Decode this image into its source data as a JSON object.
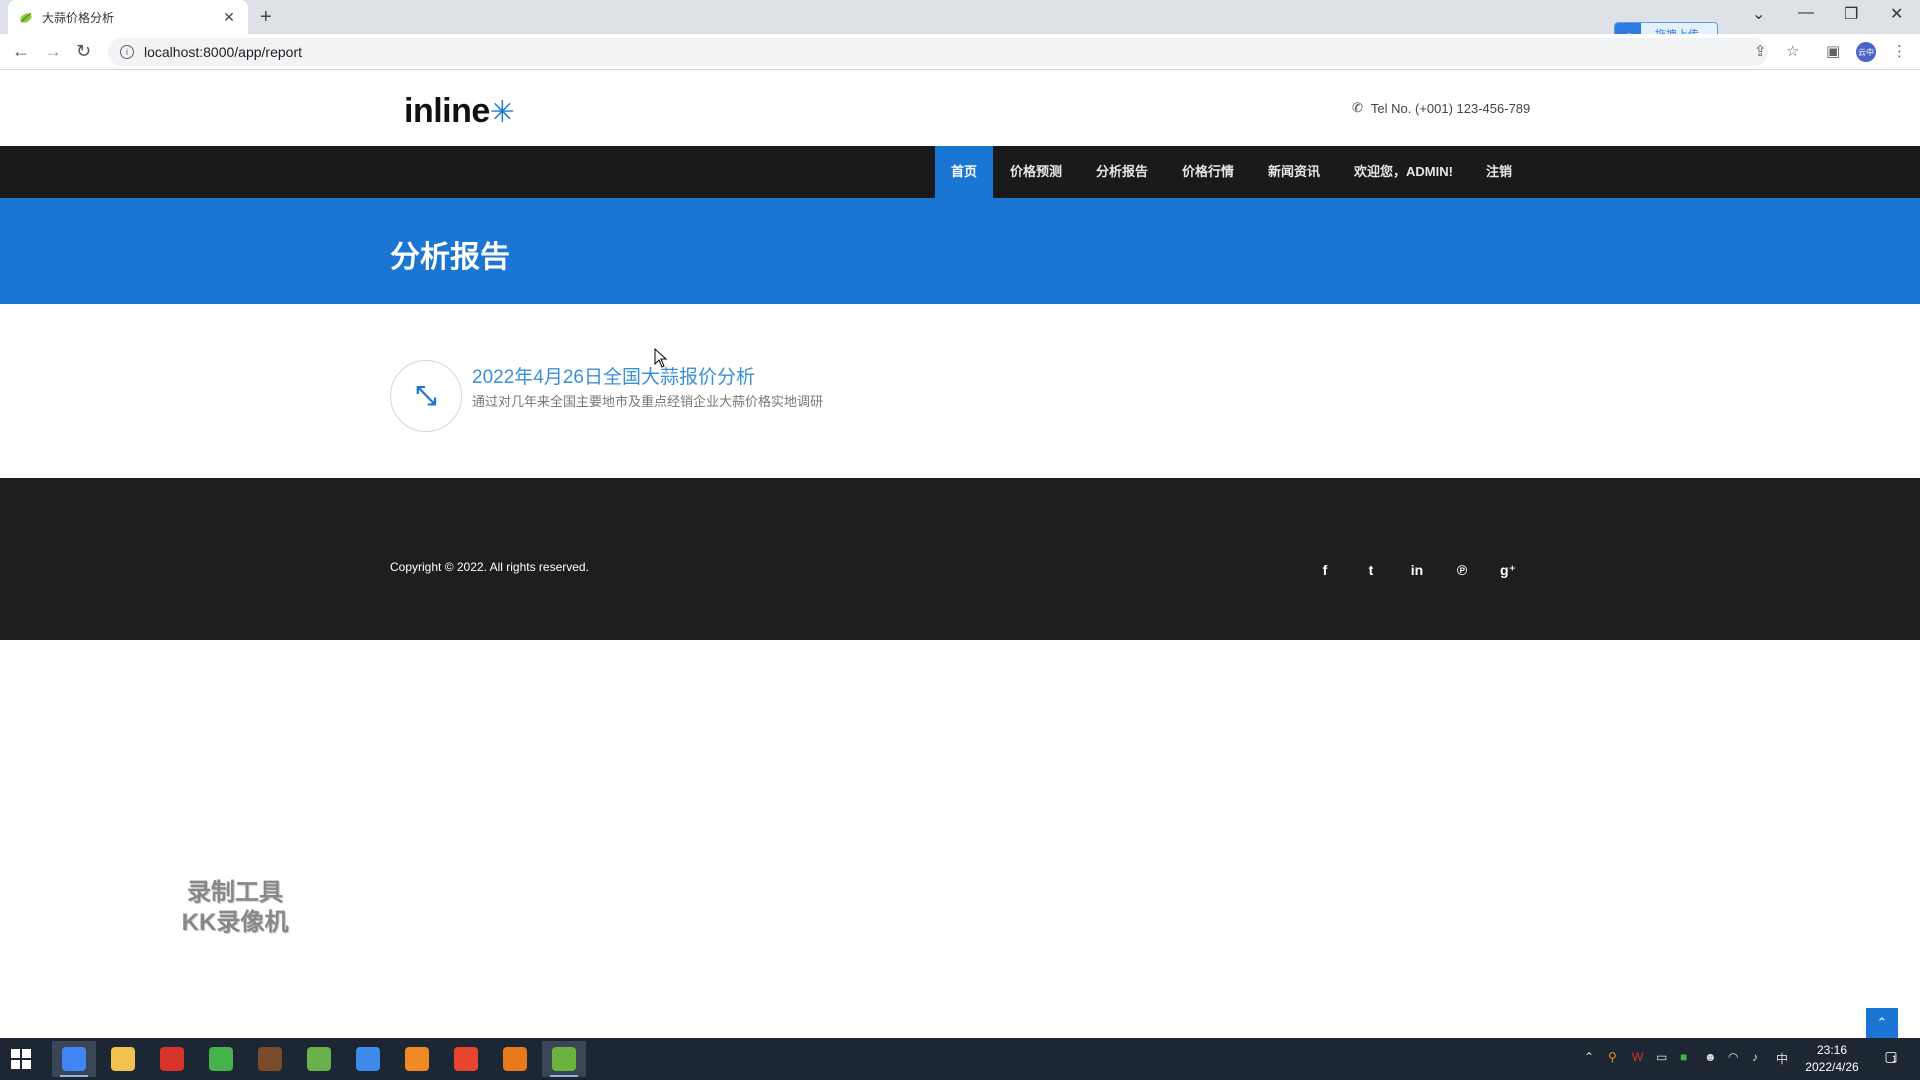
{
  "browser": {
    "tab_title": "大蒜价格分析",
    "tab_close": "✕",
    "new_tab": "+",
    "url": "localhost:8000/app/report",
    "upload_label": "拖拽上传",
    "profile_initials": "云中",
    "window_controls": {
      "minimize": "—",
      "restore": "❐",
      "close": "✕",
      "dropdown": "⌄"
    },
    "nav": {
      "back": "←",
      "forward": "→",
      "reload": "↻"
    }
  },
  "site": {
    "logo_text": "inline",
    "logo_mark": "✳",
    "tel": "Tel No. (+001) 123-456-789",
    "nav": [
      {
        "label": "首页",
        "active": true
      },
      {
        "label": "价格预测"
      },
      {
        "label": "分析报告"
      },
      {
        "label": "价格行情"
      },
      {
        "label": "新闻资讯"
      },
      {
        "label": "欢迎您，ADMIN!"
      },
      {
        "label": "注销"
      }
    ],
    "page_title": "分析报告",
    "report": {
      "title": "2022年4月26日全国大蒜报价分析",
      "description": "通过对几年来全国主要地市及重点经销企业大蒜价格实地调研",
      "icon": "compress-arrows-icon"
    },
    "footer": {
      "copyright": "Copyright © 2022. All rights reserved.",
      "social": [
        {
          "name": "facebook",
          "glyph": "f"
        },
        {
          "name": "twitter",
          "glyph": "t"
        },
        {
          "name": "linkedin",
          "glyph": "in"
        },
        {
          "name": "pinterest",
          "glyph": "℗"
        },
        {
          "name": "google-plus",
          "glyph": "g⁺"
        }
      ]
    },
    "back_to_top": "⌃",
    "watermark_line1": "录制工具",
    "watermark_line2": "KK录像机"
  },
  "taskbar": {
    "time": "23:16",
    "date": "2022/4/26",
    "ime": "中",
    "notification_count": "1",
    "apps": [
      {
        "name": "chrome",
        "color": "#4285f4",
        "active": true
      },
      {
        "name": "file-explorer",
        "color": "#f2c14e"
      },
      {
        "name": "wps-office",
        "color": "#d9342b"
      },
      {
        "name": "leaf-app",
        "color": "#47b14d"
      },
      {
        "name": "pixel-app",
        "color": "#7a4b2b"
      },
      {
        "name": "notepad-app",
        "color": "#6ab04c"
      },
      {
        "name": "baidu-netdisk",
        "color": "#3d8be8"
      },
      {
        "name": "search-app",
        "color": "#f08a24"
      },
      {
        "name": "video-app",
        "color": "#e8452e"
      },
      {
        "name": "game-app",
        "color": "#e87a1e"
      },
      {
        "name": "spring-app",
        "color": "#6db33f",
        "active": true
      }
    ]
  }
}
